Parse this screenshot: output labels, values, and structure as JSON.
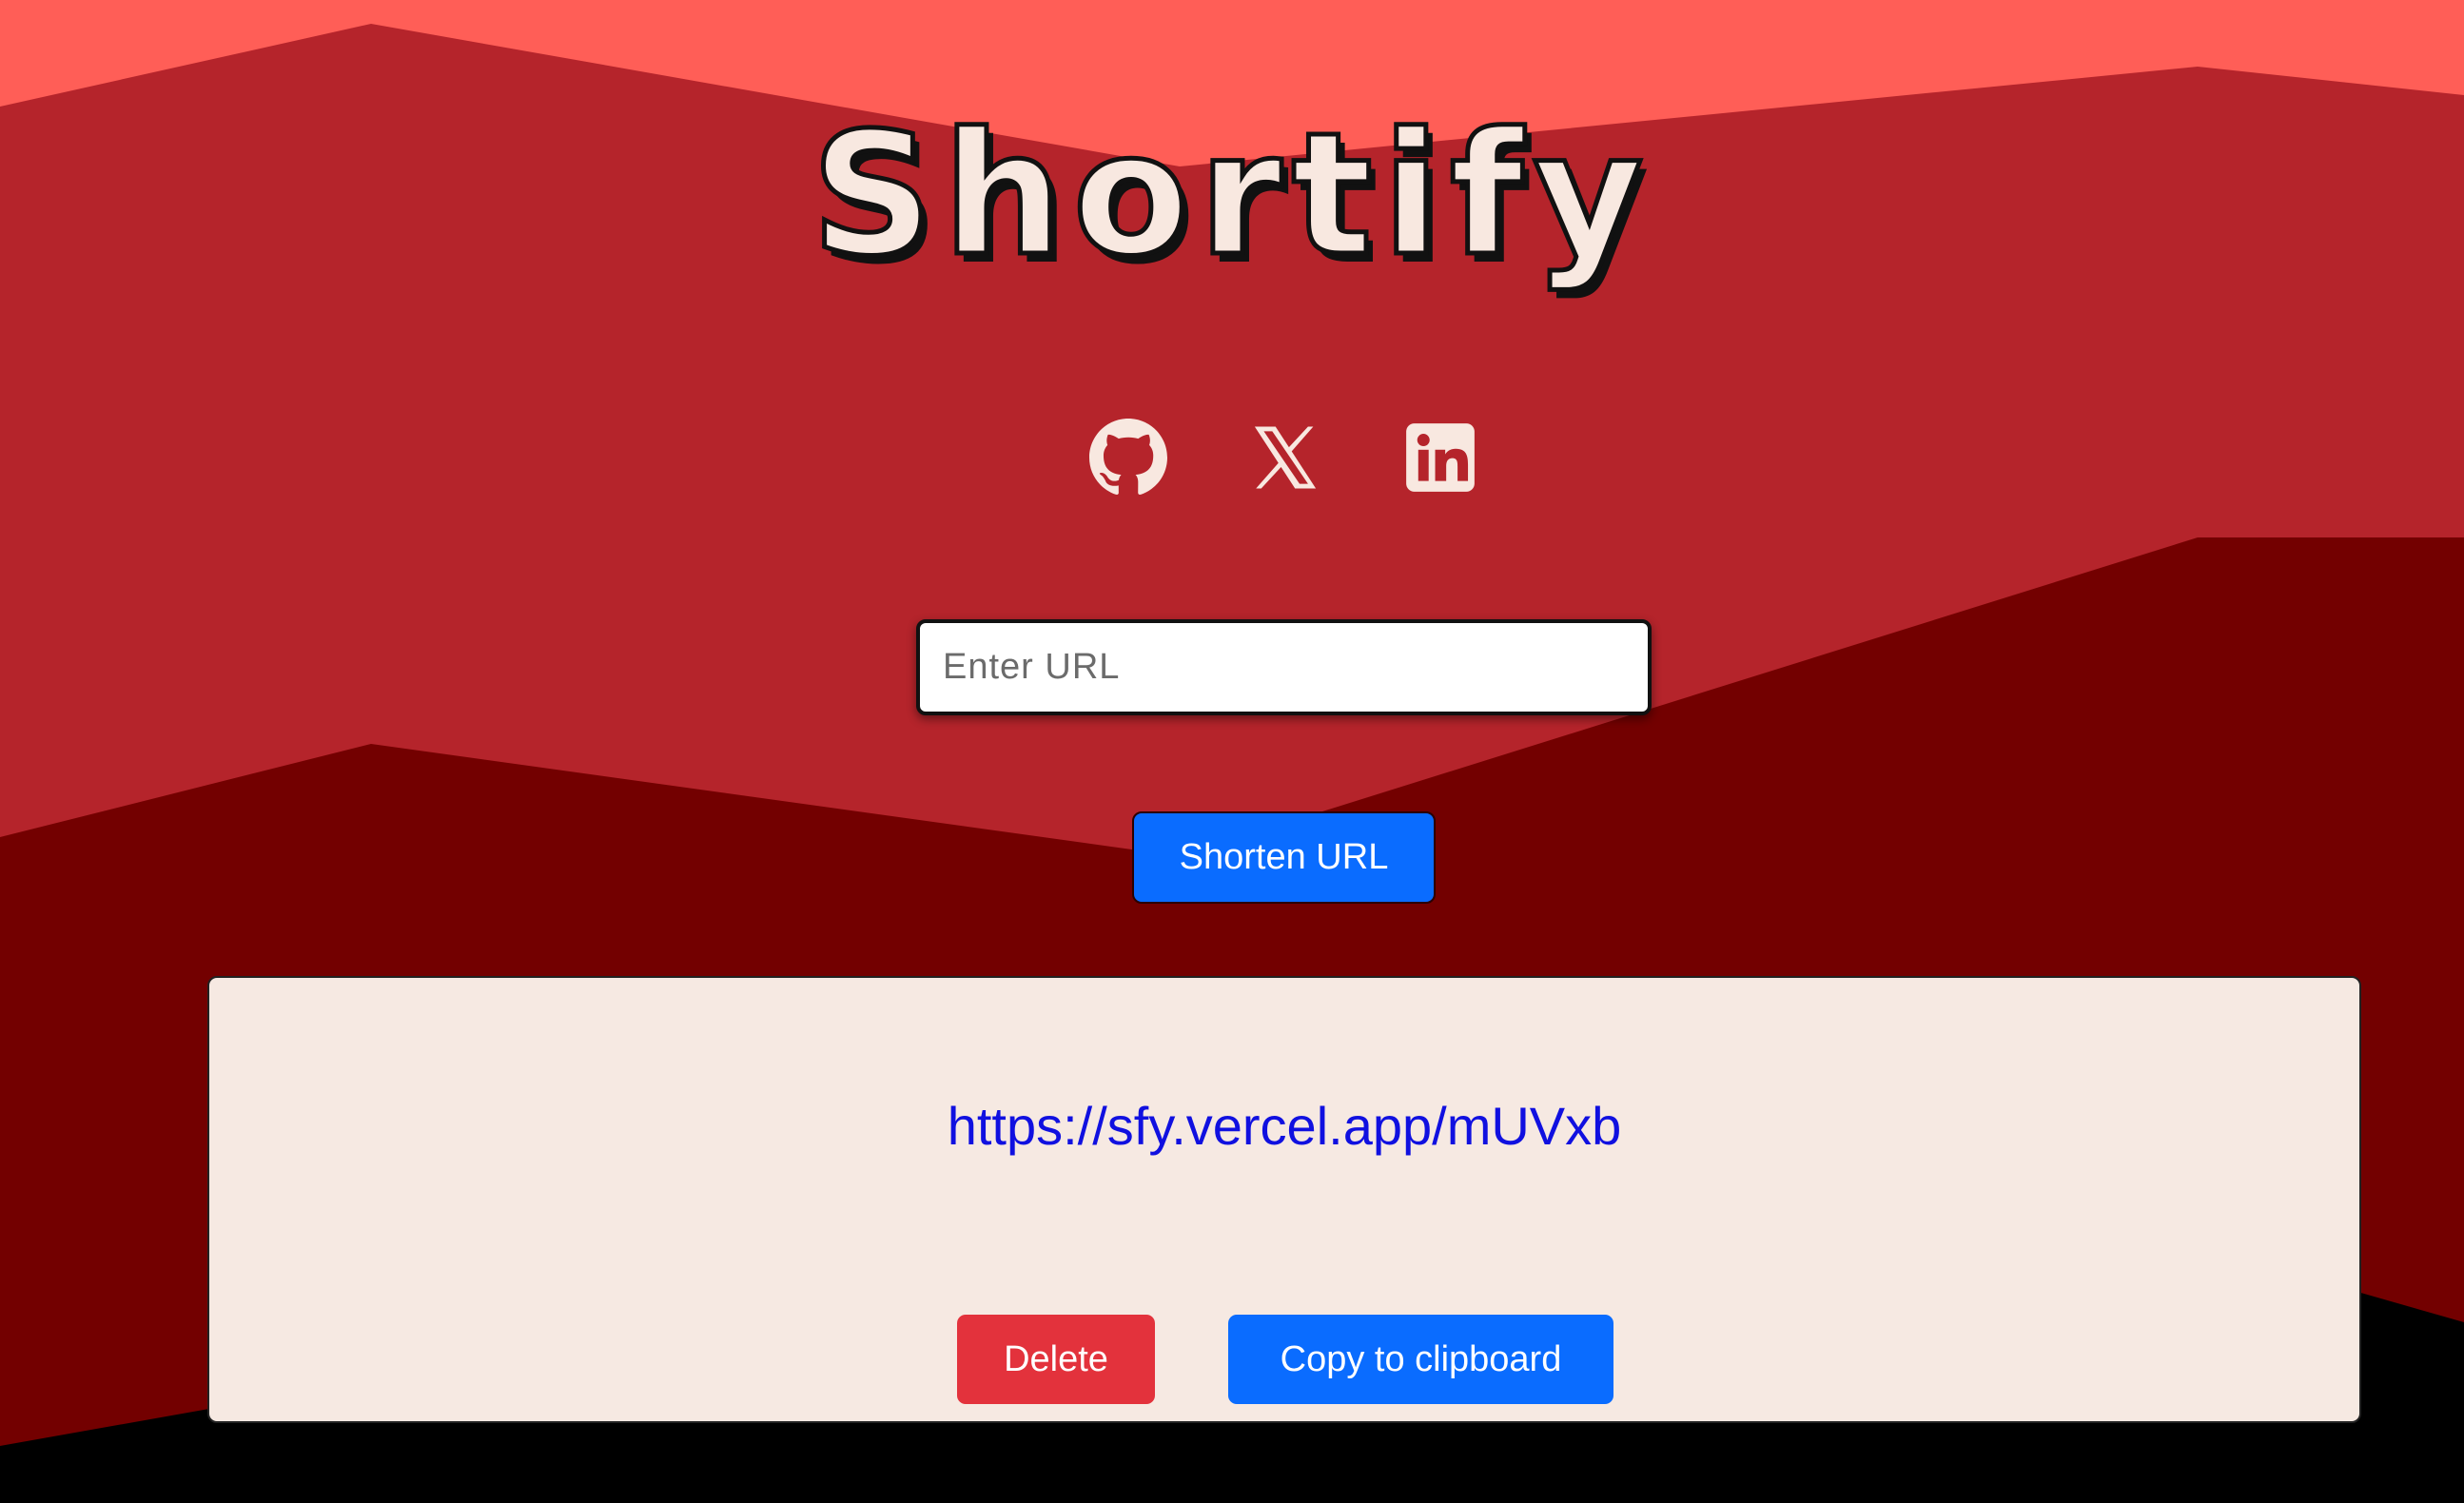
{
  "app": {
    "title": "Shortify"
  },
  "social": {
    "github": "github-icon",
    "x": "x-icon",
    "linkedin": "linkedin-icon"
  },
  "form": {
    "input_placeholder": "Enter URL",
    "input_value": "",
    "submit_label": "Shorten URL"
  },
  "result": {
    "short_url": "https://sfy.vercel.app/mUVxb",
    "delete_label": "Delete",
    "copy_label": "Copy to clipboard"
  },
  "colors": {
    "bg_light_red": "#ff5e57",
    "bg_mid_red": "#b5242b",
    "bg_dark_red": "#730000",
    "bg_black": "#000000",
    "primary_blue": "#0a6cff",
    "danger_red": "#e3323c",
    "card_bg": "#f6e9e2",
    "title_fill": "#f8e8e0",
    "link_blue": "#1010e0"
  }
}
